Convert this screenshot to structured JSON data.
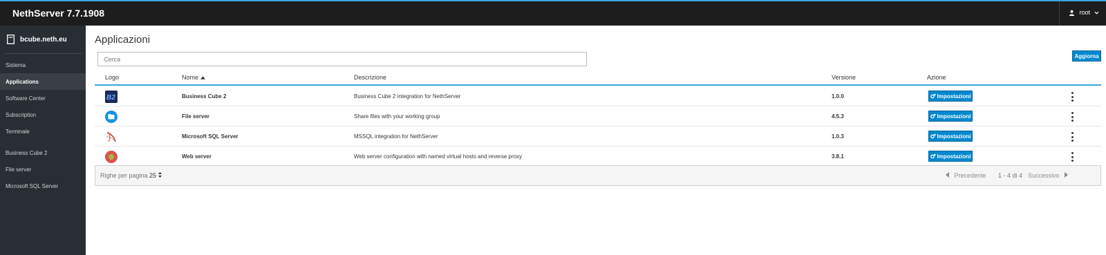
{
  "app": {
    "title": "NethServer 7.7.1908",
    "user": "root"
  },
  "sidebar": {
    "host": "bcube.neth.eu",
    "items": [
      {
        "label": "Sistema"
      },
      {
        "label": "Applications"
      },
      {
        "label": "Software Center"
      },
      {
        "label": "Subscription"
      },
      {
        "label": "Terminale"
      }
    ],
    "apps": [
      {
        "label": "Business Cube 2"
      },
      {
        "label": "File server"
      },
      {
        "label": "Microsoft SQL Server"
      }
    ]
  },
  "main": {
    "title": "Applicazioni",
    "search_placeholder": "Cerca",
    "refresh_label": "Aggiorna",
    "columns": {
      "logo": "Logo",
      "name": "Nome",
      "description": "Descrizione",
      "version": "Versione",
      "action": "Azione"
    },
    "rows": [
      {
        "name": "Business Cube 2",
        "description": "Business Cube 2 integration for NethServer",
        "version": "1.0.0",
        "action": "Impostazioni",
        "logo": "b2-logo-icon"
      },
      {
        "name": "File server",
        "description": "Share files with your working group",
        "version": "4.5.3",
        "action": "Impostazioni",
        "logo": "file-server-logo-icon"
      },
      {
        "name": "Microsoft SQL Server",
        "description": "MSSQL integration for NethServer",
        "version": "1.0.3",
        "action": "Impostazioni",
        "logo": "mssql-logo-icon"
      },
      {
        "name": "Web server",
        "description": "Web server configuration with named virtual hosts and reverse proxy",
        "version": "3.8.1",
        "action": "Impostazioni",
        "logo": "web-server-logo-icon"
      }
    ],
    "pager": {
      "per_page_label": "Righe per pagina",
      "per_page": "25",
      "prev": "Precedente",
      "range": "1 - 4 di 4",
      "next": "Successivo"
    }
  },
  "colors": {
    "accent": "#0088ce",
    "topbar": "#1d1d1d",
    "sidebar": "#292e34",
    "active_item": "#393f44"
  }
}
